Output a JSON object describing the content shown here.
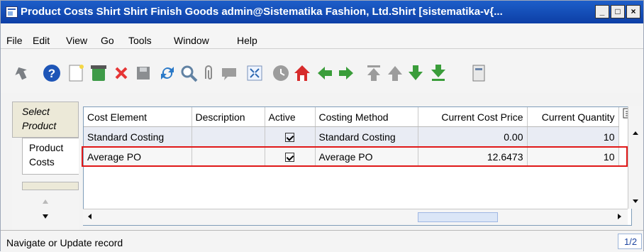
{
  "window": {
    "title": "Product Costs  Shirt  Shirt Finish Goods  admin@Sistematika Fashion, Ltd.Shirt [sistematika-v{...",
    "controls": [
      "_",
      "□",
      "×"
    ]
  },
  "menu": [
    "File",
    "Edit",
    "View",
    "Go",
    "Tools",
    "Window",
    "Help"
  ],
  "toolbar": {
    "icons": [
      "undo-icon",
      "help-icon",
      "new-record-icon",
      "delete-record-icon",
      "delete-selection-icon",
      "save-icon",
      "refresh-icon",
      "find-icon",
      "attachment-icon",
      "chat-icon",
      "grid-toggle-icon",
      "history-icon",
      "home-icon",
      "previous-record-icon",
      "next-record-icon",
      "first-record-icon",
      "previous-page-icon",
      "next-page-icon",
      "last-record-icon",
      "report-icon"
    ]
  },
  "tabs": [
    "Select",
    "Product",
    "Product",
    "Costs"
  ],
  "grid": {
    "columns": [
      "Cost Element",
      "Description",
      "Active",
      "Costing Method",
      "Current Cost Price",
      "Current Quantity"
    ],
    "rows": [
      {
        "cost_element": "Standard Costing",
        "description": "",
        "active": true,
        "costing_method": "Standard Costing",
        "current_cost_price": "0.00",
        "current_quantity": "10"
      },
      {
        "cost_element": "Average PO",
        "description": "",
        "active": true,
        "costing_method": "Average PO",
        "current_cost_price": "12.6473",
        "current_quantity": "10"
      }
    ],
    "selected_row": 1
  },
  "status": {
    "message": "Navigate or Update record",
    "page": "1/2"
  },
  "colors": {
    "title_bar": "#0d3fa6",
    "highlight": "#e01818",
    "selected_row": "#f7f7f7"
  }
}
